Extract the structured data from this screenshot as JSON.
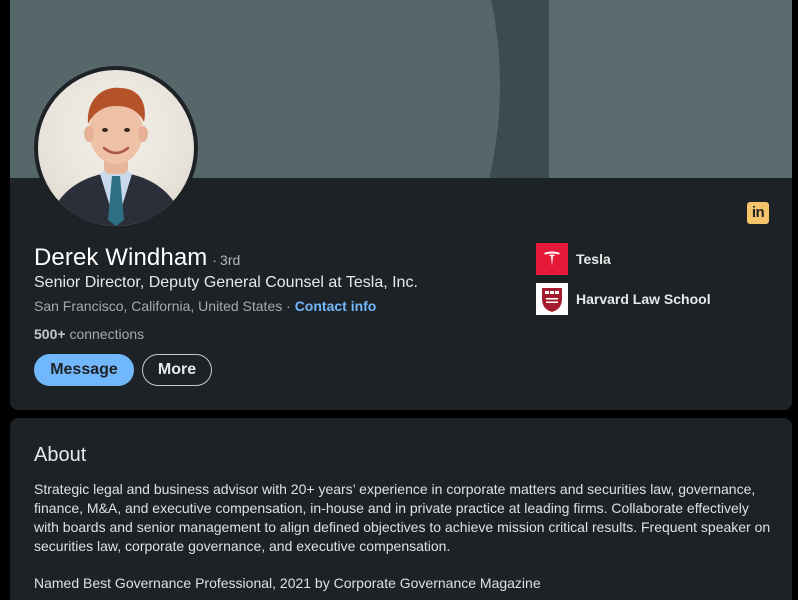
{
  "profile": {
    "name": "Derek Windham",
    "degree_sep": "·",
    "degree": "3rd",
    "headline": "Senior Director, Deputy General Counsel at Tesla, Inc.",
    "location": "San Francisco, California, United States",
    "location_sep": "·",
    "contact_link": "Contact info",
    "connections_count": "500+",
    "connections_label": "connections"
  },
  "actions": {
    "message_label": "Message",
    "more_label": "More"
  },
  "companies": [
    {
      "name": "Tesla",
      "logo": "tesla-logo"
    },
    {
      "name": "Harvard Law School",
      "logo": "harvard-law-logo"
    }
  ],
  "brand_icon": {
    "text": "in",
    "name": "linkedin-icon"
  },
  "about": {
    "title": "About",
    "text": "Strategic legal and business advisor with 20+ years’ experience in corporate matters and securities law, governance, finance, M&A, and executive compensation, in-house and in private practice at leading firms. Collaborate effectively with boards and senior management to align defined objectives to achieve mission critical results. Frequent speaker on securities law, corporate governance, and executive compensation.",
    "award": "Named Best Governance Professional, 2021 by Corporate Governance Magazine"
  },
  "colors": {
    "card_bg": "#1d2226",
    "banner": "#56676a",
    "accent_blue": "#71b7fb",
    "linkedin_badge": "#f5c46b",
    "tesla_red": "#e31937"
  }
}
